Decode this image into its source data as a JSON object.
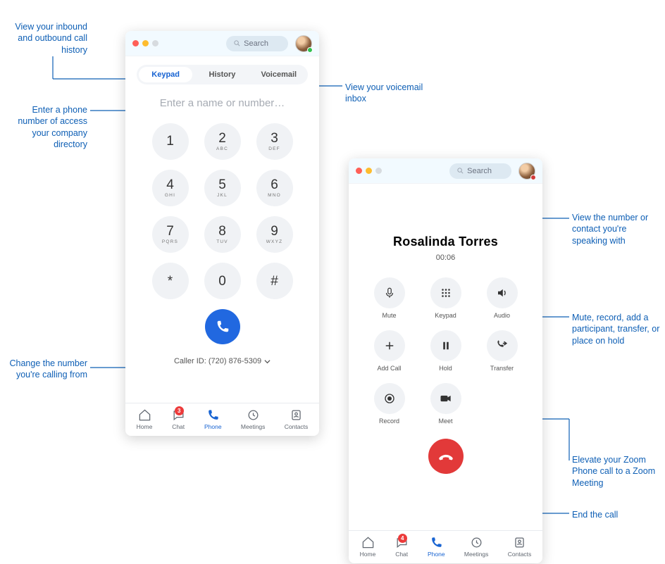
{
  "callouts": {
    "history": "View your inbound and outbound call history",
    "voicemail": "View your voicemail inbox",
    "directory": "Enter a phone number of access your company directory",
    "callerid": "Change the number you're calling from",
    "calleeName": "View the number or contact you're speaking with",
    "controls": "Mute, record, add a participant, transfer, or place on hold",
    "elevate": "Elevate your Zoom Phone call to a Zoom Meeting",
    "endcall": "End the call"
  },
  "search": {
    "placeholder": "Search"
  },
  "tabs": {
    "keypad": "Keypad",
    "history": "History",
    "voicemail": "Voicemail"
  },
  "dialer": {
    "placeholder": "Enter a name or number…",
    "callerid_label": "Caller ID: (720) 876-5309",
    "keys": [
      {
        "d": "1",
        "l": ""
      },
      {
        "d": "2",
        "l": "ABC"
      },
      {
        "d": "3",
        "l": "DEF"
      },
      {
        "d": "4",
        "l": "GHI"
      },
      {
        "d": "5",
        "l": "JKL"
      },
      {
        "d": "6",
        "l": "MNO"
      },
      {
        "d": "7",
        "l": "PQRS"
      },
      {
        "d": "8",
        "l": "TUV"
      },
      {
        "d": "9",
        "l": "WXYZ"
      },
      {
        "d": "*",
        "l": ""
      },
      {
        "d": "0",
        "l": ""
      },
      {
        "d": "#",
        "l": ""
      }
    ]
  },
  "incall": {
    "name": "Rosalinda Torres",
    "time": "00:06",
    "actions": {
      "mute": "Mute",
      "keypad": "Keypad",
      "audio": "Audio",
      "add": "Add Call",
      "hold": "Hold",
      "transfer": "Transfer",
      "record": "Record",
      "meet": "Meet"
    }
  },
  "nav": {
    "home": "Home",
    "chat": "Chat",
    "phone": "Phone",
    "meetings": "Meetings",
    "contacts": "Contacts",
    "chat_badge_dialer": "3",
    "chat_badge_incall": "4"
  }
}
